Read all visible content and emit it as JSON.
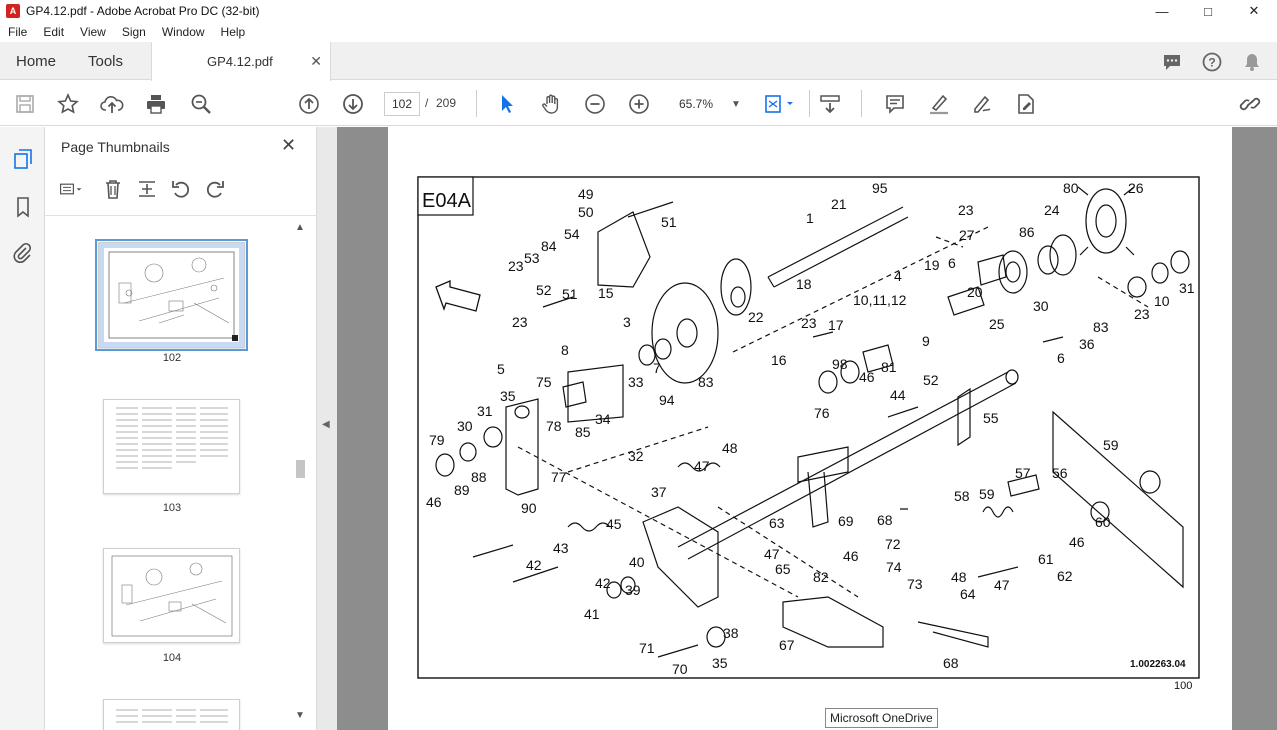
{
  "window": {
    "title": "GP4.12.pdf - Adobe Acrobat Pro DC (32-bit)"
  },
  "menu": [
    "File",
    "Edit",
    "View",
    "Sign",
    "Window",
    "Help"
  ],
  "tabs": {
    "home": "Home",
    "tools": "Tools",
    "document": "GP4.12.pdf"
  },
  "toolbar": {
    "current_page": "102",
    "separator": "/",
    "total_pages": "209",
    "zoom": "65.7%"
  },
  "sidebar": {
    "title": "Page Thumbnails",
    "thumbnails": [
      {
        "label": "102",
        "selected": true
      },
      {
        "label": "103",
        "selected": false
      },
      {
        "label": "104",
        "selected": false
      }
    ]
  },
  "diagram": {
    "ref_code": "E04A",
    "drawing_number": "1.002263.04",
    "page_number": "100",
    "callouts": [
      "49",
      "50",
      "51",
      "53",
      "84",
      "54",
      "23",
      "52",
      "51",
      "23",
      "15",
      "21",
      "95",
      "1",
      "18",
      "22",
      "23",
      "27",
      "80",
      "26",
      "24",
      "86",
      "6",
      "19",
      "20",
      "25",
      "30",
      "31",
      "10",
      "23",
      "83",
      "36",
      "6",
      "4",
      "3",
      "8",
      "7",
      "33",
      "83",
      "23",
      "17",
      "10,11,12",
      "9",
      "16",
      "98",
      "46",
      "81",
      "44",
      "52",
      "76",
      "5",
      "75",
      "35",
      "94",
      "34",
      "85",
      "32",
      "31",
      "30",
      "79",
      "78",
      "77",
      "90",
      "88",
      "89",
      "46",
      "48",
      "47",
      "37",
      "55",
      "59",
      "56",
      "57",
      "58",
      "59",
      "60",
      "46",
      "62",
      "61",
      "47",
      "48",
      "45",
      "43",
      "42",
      "41",
      "42",
      "39",
      "40",
      "38",
      "35",
      "70",
      "71",
      "63",
      "47",
      "65",
      "69",
      "46",
      "82",
      "68",
      "72",
      "74",
      "73",
      "64",
      "68",
      "67"
    ]
  },
  "tooltip": "Microsoft OneDrive",
  "colors": {
    "accent_blue": "#1473e6",
    "selection": "#5b9bd5",
    "canvas_gray": "#8d8d8d"
  },
  "icons": [
    "save-icon",
    "star-icon",
    "upload-icon",
    "print-icon",
    "zoom-search-icon",
    "page-up-icon",
    "page-down-icon",
    "select-arrow-icon",
    "hand-icon",
    "zoom-out-icon",
    "zoom-in-icon",
    "fit-page-icon",
    "scroll-mode-icon",
    "comment-icon",
    "highlight-icon",
    "sign-icon",
    "edit-pdf-icon",
    "share-link-icon"
  ]
}
